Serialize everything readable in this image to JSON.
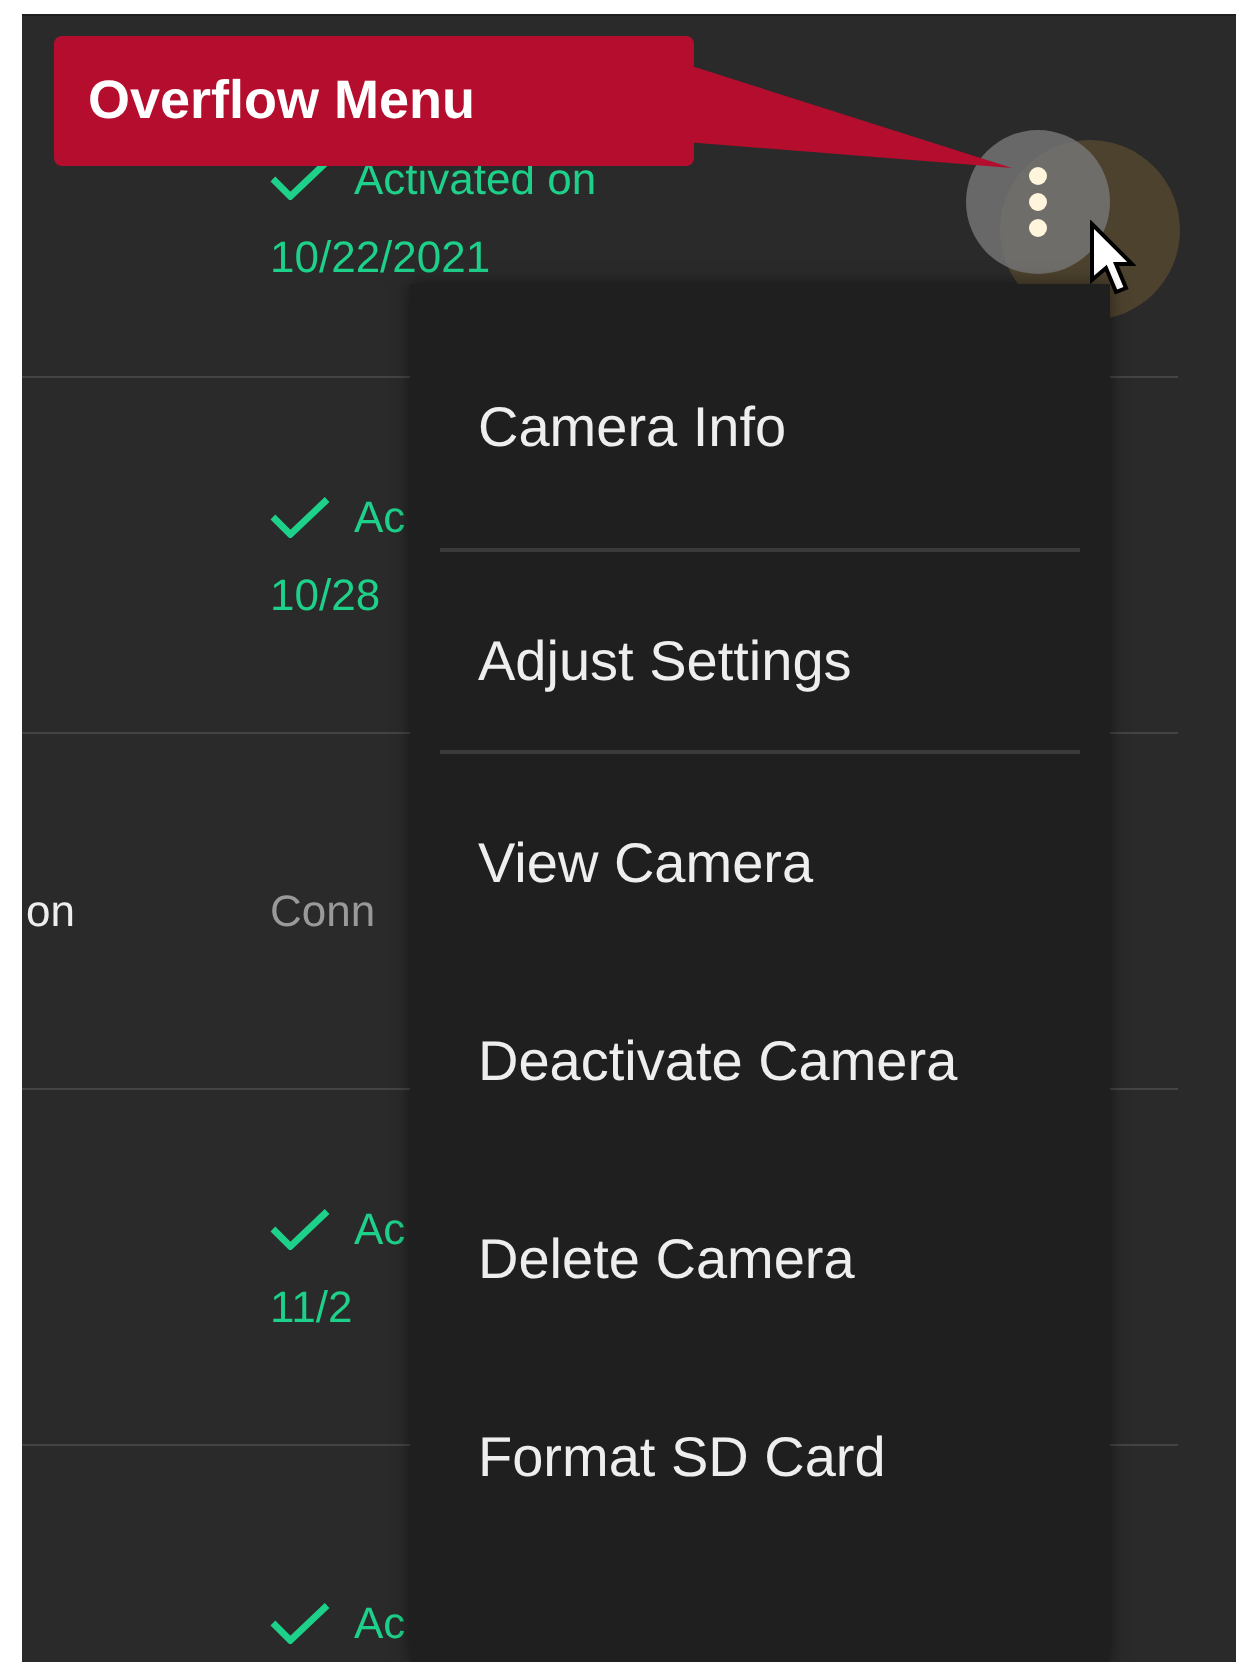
{
  "rows": [
    {
      "label": null,
      "status": "Activated on",
      "date": "10/22/2021",
      "kind": "activated"
    },
    {
      "label": null,
      "status": "Ac",
      "date": "10/28",
      "kind": "activated"
    },
    {
      "label": "on",
      "status": "Conn",
      "date": null,
      "kind": "connecting"
    },
    {
      "label": null,
      "status": "Ac",
      "date": "11/2",
      "kind": "activated"
    },
    {
      "label": null,
      "status": "Ac",
      "date": null,
      "kind": "activated"
    }
  ],
  "callout": {
    "text": "Overflow Menu"
  },
  "menu": {
    "items": [
      {
        "label": "Camera Info",
        "divider_after": true
      },
      {
        "label": "Adjust Settings",
        "divider_after": true
      },
      {
        "label": "View Camera",
        "divider_after": false
      },
      {
        "label": "Deactivate Camera",
        "divider_after": false
      },
      {
        "label": "Delete Camera",
        "divider_after": false
      },
      {
        "label": "Format SD Card",
        "divider_after": false
      }
    ]
  }
}
